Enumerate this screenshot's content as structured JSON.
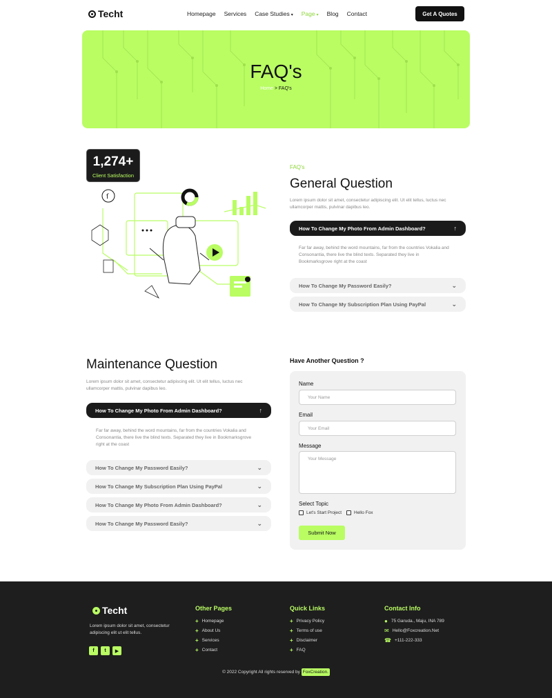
{
  "nav": {
    "logo": "Techt",
    "items": [
      {
        "label": "Homepage"
      },
      {
        "label": "Services"
      },
      {
        "label": "Case Studies",
        "caret": "▾"
      },
      {
        "label": "Page",
        "caret": "▾"
      },
      {
        "label": "Blog"
      },
      {
        "label": "Contact"
      }
    ],
    "cta": "Get A Quotes"
  },
  "hero": {
    "title": "FAQ's",
    "crumb_home": "Home",
    "crumb_rest": " > FAQ's"
  },
  "stat": {
    "value": "1,274+",
    "label": "Client Satisfaction"
  },
  "general": {
    "eyebrow": "FAQ's",
    "title": "General Question",
    "lead_1": "Lorem ipsum dolor sit amet, consectetur adipiscing elit. Ut elit tellus, luctus nec",
    "lead_2": "ullamcorper mattis, pulvinar dapibus leo.",
    "open_question": "How To Change My Photo From Admin Dashboard?",
    "answer_1": "Far far away, behind the word mountains, far from the countries Vokalia and",
    "answer_2": "Consonantia, there live the blind texts. Separated they live in",
    "answer_3": "Bookmarksgrove right at the coast",
    "q2": "How To Change My Password Easily?",
    "q3": "How To Change My Subscription Plan Using PayPal"
  },
  "maintenance": {
    "title": "Maintenance Question",
    "lead_1": "Lorem ipsum dolor sit amet, consectetur adipiscing elit. Ut elit tellus, luctus nec",
    "lead_2": "ullamcorper mattis, pulvinar dapibus leo.",
    "open_question": "How To Change My Photo From Admin Dashboard?",
    "answer_1": "Far far away, behind the word mountains, far from the countries Vokalia and",
    "answer_2": "Consonantia, there live the blind texts. Separated they live in Bookmarksgrove",
    "answer_3": "right at the coast",
    "q2": "How To Change My Password Easily?",
    "q3": "How To Change My Subscription Plan Using PayPal",
    "q4": "How To Change My Photo From Admin Dashboard?",
    "q5": "How To Change My Password Easily?"
  },
  "form": {
    "heading": "Have Another Question ?",
    "name_label": "Name",
    "name_placeholder": "Your Name",
    "email_label": "Email",
    "email_placeholder": "Your Email",
    "message_label": "Message",
    "message_placeholder": "Your Message",
    "topic_label": "Select Topic",
    "topic_1": "Let's Start Project",
    "topic_2": "Hello Fox",
    "submit": "Submit Now"
  },
  "footer": {
    "logo": "Techt",
    "about_1": "Lorem ipsum dolor sit amet, consectetur",
    "about_2": "adipiscing elit ut elit tellus.",
    "other_title": "Other Pages",
    "other": [
      "Homepage",
      "About Us",
      "Services",
      "Contact"
    ],
    "quick_title": "Quick Links",
    "quick": [
      "Privacy Policy",
      "Terms of use",
      "Disclaimer",
      "FAQ"
    ],
    "contact_title": "Contact Info",
    "address": "75 Garuda., Maju, INA 789",
    "email": "Hello@Foxcreation.Net",
    "phone": "+111-222-333",
    "copyright": "© 2022 Copyright All rights reserved by",
    "brand": "FoxCreation."
  },
  "colors": {
    "accent": "#b9fd63",
    "dark": "#1b1b1b",
    "muted": "#888888"
  }
}
